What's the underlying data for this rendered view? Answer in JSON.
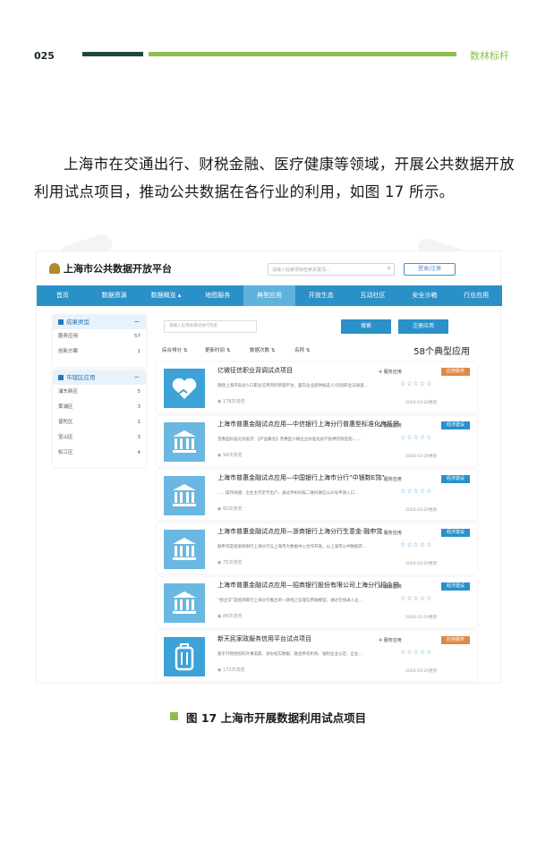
{
  "page": {
    "number": "025",
    "brand": "数林标杆"
  },
  "paragraph": "上海市在交通出行、财税金融、医疗健康等领域，开展公共数据开放利用试点项目，推动公共数据在各行业的利用，如图 17 所示。",
  "screenshot": {
    "site_title": "上海市公共数据开放平台",
    "search_placeholder": "请输入检索项目检索关键词...",
    "login_label": "登录/注册",
    "nav": [
      "首页",
      "数据资源",
      "数据概览 ▴",
      "地图服务",
      "典型应用",
      "开放生态",
      "互动社区",
      "安全沙箱",
      "行业应用"
    ],
    "sidebar": {
      "panel1": {
        "title": "成果类型",
        "items": [
          {
            "label": "服务应用",
            "count": "57"
          },
          {
            "label": "创新方案",
            "count": "1"
          }
        ]
      },
      "panel2": {
        "title": "市辖区应用",
        "items": [
          {
            "label": "浦东新区",
            "count": "5"
          },
          {
            "label": "黄浦区",
            "count": "3"
          },
          {
            "label": "普陀区",
            "count": "1"
          },
          {
            "label": "宝山区",
            "count": "3"
          },
          {
            "label": "松江区",
            "count": "4"
          }
        ]
      }
    },
    "main": {
      "search_input": "请输入应用关键词进行检索",
      "search_button": "搜索",
      "register_button": "注册应用",
      "sorts": [
        "综合排分",
        "更新时间",
        "数据次数",
        "名称"
      ],
      "total": "58个典型应用",
      "cards": [
        {
          "title": "亿微征信职业背调试点项目",
          "desc": "围绕上海市高动人口职业信用风险管理平台，面向企业提供候选人(包括职业记录查…",
          "views": "178次浏览",
          "tag": "服务应用",
          "badge": "应用服务",
          "date": "2020-10-29更新",
          "icon": "heart-hand-icon"
        },
        {
          "title": "上海市普惠金融试点应用—中信银行上海分行普惠型标准化房抵贷",
          "desc": "普惠型标准化房抵贷：【产品概念】普惠型小微企业标准化房产抵押贷款是指……",
          "views": "94次浏览",
          "tag": "服务应用",
          "badge": "经济建设",
          "date": "2020-10-29更新",
          "icon": "bank-icon"
        },
        {
          "title": "上海市普惠金融试点应用—中国银行上海市分行“中银数E贷”",
          "desc": "…、操作快捷、企业主可足不出户，通过手机扫描二维码微信公众号申请入口…",
          "views": "82次浏览",
          "tag": "服务应用",
          "badge": "经济建设",
          "date": "2020-10-29更新",
          "icon": "bank-icon"
        },
        {
          "title": "上海市普惠金融试点应用—浙商银行上海分行生意金·融申贷",
          "desc": "融申贷是指浙商银行上海分行与上海市大数据中心合作开发，以上海市公共数据开…",
          "views": "75次浏览",
          "tag": "服务应用",
          "badge": "经济建设",
          "date": "2020-10-29更新",
          "icon": "bank-icon"
        },
        {
          "title": "上海市普惠金融试点应用—招商银行股份有限公司上海分行招企贷",
          "desc": "“招企贷”是招商银行上海分行推出的一款线上信理信用融模型，通过在线录入企…",
          "views": "84次浏览",
          "tag": "服务应用",
          "badge": "经济建设",
          "date": "2020-10-29更新",
          "icon": "bank-icon"
        },
        {
          "title": "新天民家政服务信用平台试点项目",
          "desc": "基于行政授权的外事案底、身份核实数据、融合养老机构、福利企业认定、企业…",
          "views": "172次浏览",
          "tag": "服务应用",
          "badge": "应用服务",
          "date": "2020-10-29更新",
          "icon": "luggage-icon"
        }
      ]
    }
  },
  "caption": "图 17   上海市开展数据利用试点项目",
  "colors": {
    "nav": "#2a90c8",
    "accent_green": "#8cc04a",
    "dark_green": "#1f4a36",
    "badge_orange": "#e0884a",
    "badge_blue": "#2a90c8"
  }
}
